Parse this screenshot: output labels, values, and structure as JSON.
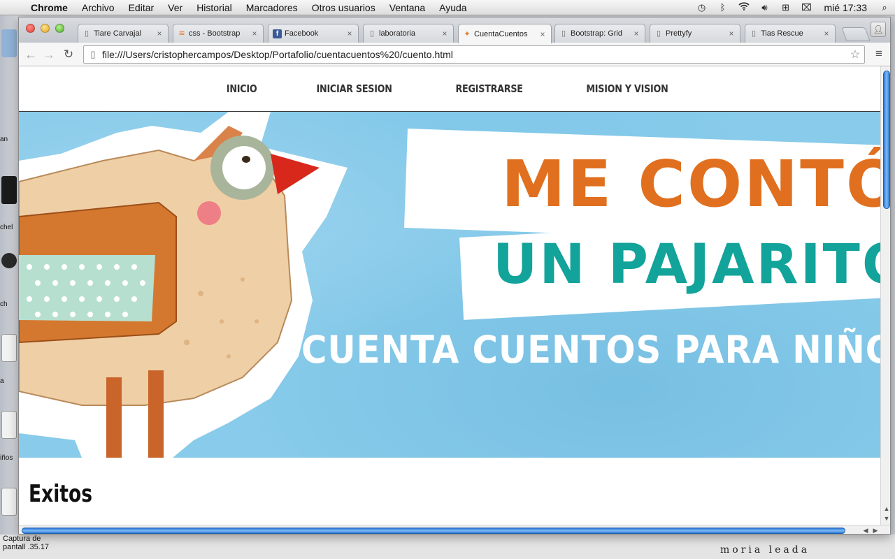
{
  "menubar": {
    "apple": "",
    "items": [
      "Chrome",
      "Archivo",
      "Editar",
      "Ver",
      "Historial",
      "Marcadores",
      "Otros usuarios",
      "Ventana",
      "Ayuda"
    ],
    "clock": "mié 17:33"
  },
  "desktop": {
    "caption_line1": "Captura de",
    "caption_line2": "pantall   .35.17",
    "scribble": "moria leada",
    "icon_labels": [
      "an",
      "chel",
      "ch",
      "a",
      "iños"
    ]
  },
  "browser": {
    "tabs": [
      {
        "title": "Tiare Carvajal",
        "icon": "page-icon"
      },
      {
        "title": "css - Bootstrap",
        "icon": "stackoverflow-icon"
      },
      {
        "title": "Facebook",
        "icon": "facebook-icon"
      },
      {
        "title": "laboratoria",
        "icon": "page-icon"
      },
      {
        "title": "CuentaCuentos",
        "icon": "bird-icon",
        "active": true
      },
      {
        "title": "Bootstrap: Grid",
        "icon": "page-icon"
      },
      {
        "title": "Prettyfy",
        "icon": "page-icon"
      },
      {
        "title": "Tias Rescue",
        "icon": "page-icon"
      }
    ],
    "url": "file:///Users/cristophercampos/Desktop/Portafolio/cuentacuentos%20/cuento.html"
  },
  "site": {
    "nav": {
      "inicio": "INICIO",
      "iniciar_sesion": "INICIAR SESION",
      "registrarse": "REGISTRARSE",
      "mision_vision": "MISION Y VISION"
    },
    "hero": {
      "title_line1": "ME CONTÓ",
      "title_line2": "UN PAJARITO",
      "subtitle": "CUENTA CUENTOS PARA NIÑOS",
      "colors": {
        "background": "#88cbea",
        "title_line1": "#e0701f",
        "title_line2": "#12a39a",
        "subtitle": "#ffffff"
      }
    },
    "section_title": "Exitos"
  }
}
